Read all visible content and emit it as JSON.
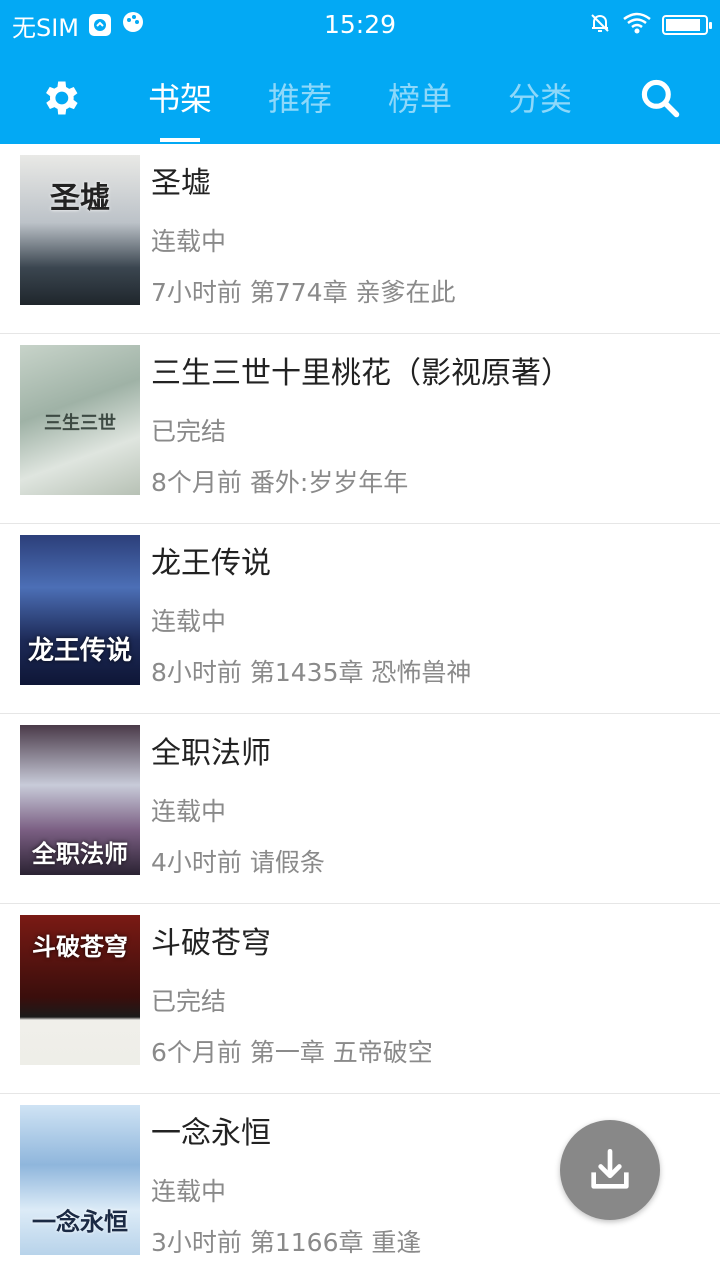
{
  "status_bar": {
    "carrier": "无SIM",
    "time": "15:29",
    "battery_level": 0.9
  },
  "nav": {
    "tabs": [
      {
        "label": "书架",
        "active": true
      },
      {
        "label": "推荐",
        "active": false
      },
      {
        "label": "榜单",
        "active": false
      },
      {
        "label": "分类",
        "active": false
      }
    ],
    "icons": {
      "left": "gear-icon",
      "right": "search-icon"
    },
    "colors": {
      "primary": "#03a9f4"
    }
  },
  "books": [
    {
      "title": "圣墟",
      "status": "连载中",
      "update": "7小时前 第774章 亲爹在此",
      "cover_text": "圣墟"
    },
    {
      "title": "三生三世十里桃花（影视原著）",
      "status": "已完结",
      "update": "8个月前 番外:岁岁年年",
      "cover_text": "三生三世"
    },
    {
      "title": "龙王传说",
      "status": "连载中",
      "update": "8小时前 第1435章 恐怖兽神",
      "cover_text": "龙王传说"
    },
    {
      "title": "全职法师",
      "status": "连载中",
      "update": "4小时前 请假条",
      "cover_text": "全职法师"
    },
    {
      "title": "斗破苍穹",
      "status": "已完结",
      "update": "6个月前 第一章 五帝破空",
      "cover_text": "斗破苍穹"
    },
    {
      "title": "一念永恒",
      "status": "连载中",
      "update": "3小时前 第1166章 重逢",
      "cover_text": "一念永恒"
    }
  ],
  "fab": {
    "icon": "download-icon"
  }
}
